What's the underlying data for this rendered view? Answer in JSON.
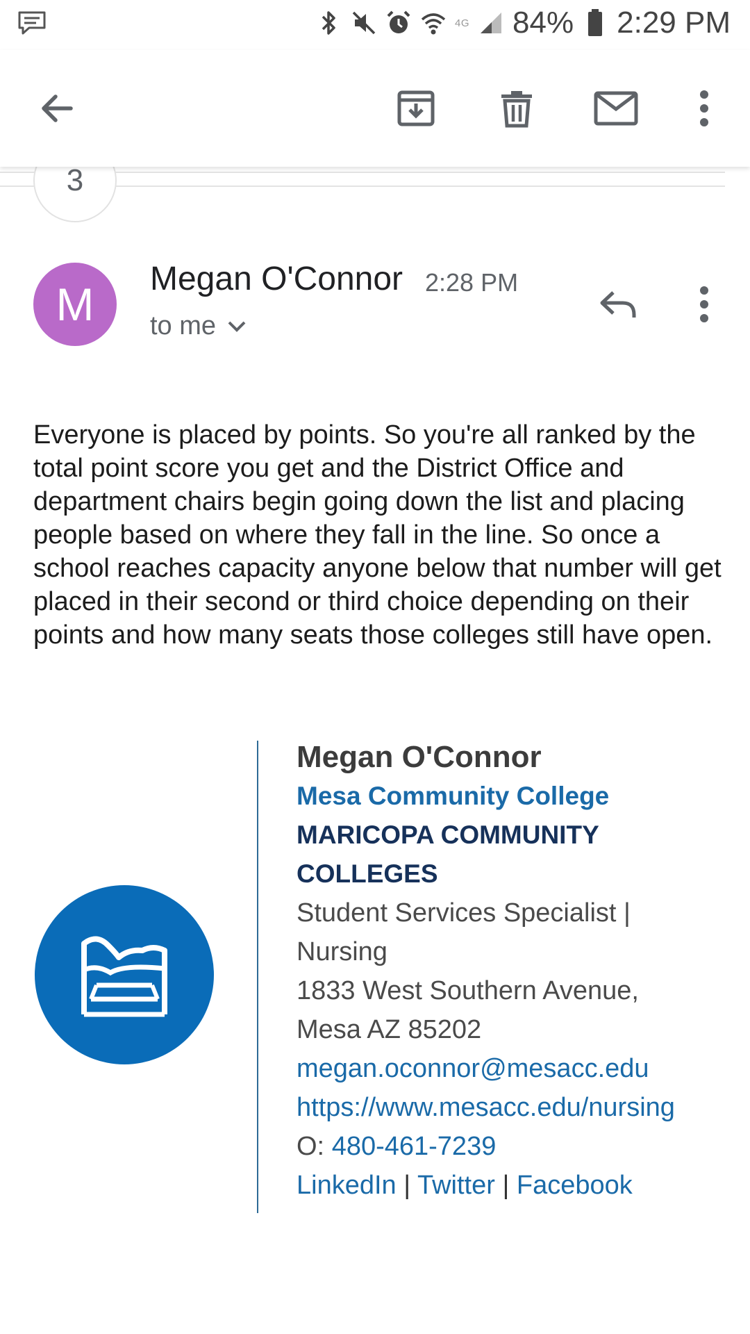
{
  "status_bar": {
    "battery": "84%",
    "time": "2:29 PM",
    "network": "4G",
    "icons": [
      "chat-bubble-icon",
      "bluetooth-icon",
      "mute-icon",
      "alarm-icon",
      "wifi-icon",
      "signal-icon",
      "battery-icon"
    ]
  },
  "toolbar": {
    "icons": [
      "back-arrow-icon",
      "archive-icon",
      "trash-icon",
      "mail-icon",
      "more-vert-icon"
    ]
  },
  "thread": {
    "collapsed_count": "3"
  },
  "message": {
    "avatar_letter": "M",
    "avatar_color": "#b96ac9",
    "sender": "Megan O'Connor",
    "time": "2:28 PM",
    "recipient": "to me",
    "body": "Everyone is placed by points. So you're all ranked by the total point score you get and the District Office and department chairs begin going down the list and placing people based on where they fall in the line. So once a school reaches capacity anyone below that number will get placed in their second or third choice depending on their points and how many seats those colleges still have open."
  },
  "signature": {
    "name": "Megan O'Connor",
    "college": "Mesa Community College",
    "district": "MARICOPA COMMUNITY COLLEGES",
    "title": "Student Services Specialist | Nursing",
    "address": "1833 West Southern Avenue, Mesa AZ 85202",
    "email": "megan.oconnor@mesacc.edu",
    "website": "https://www.mesacc.edu/nursing",
    "phone_prefix": "O:",
    "phone": "480-461-7239",
    "social": [
      "LinkedIn",
      "Twitter",
      "Facebook"
    ],
    "separator": "|",
    "logo_color": "#0a6cb8",
    "link_color": "#1a6aa8"
  }
}
